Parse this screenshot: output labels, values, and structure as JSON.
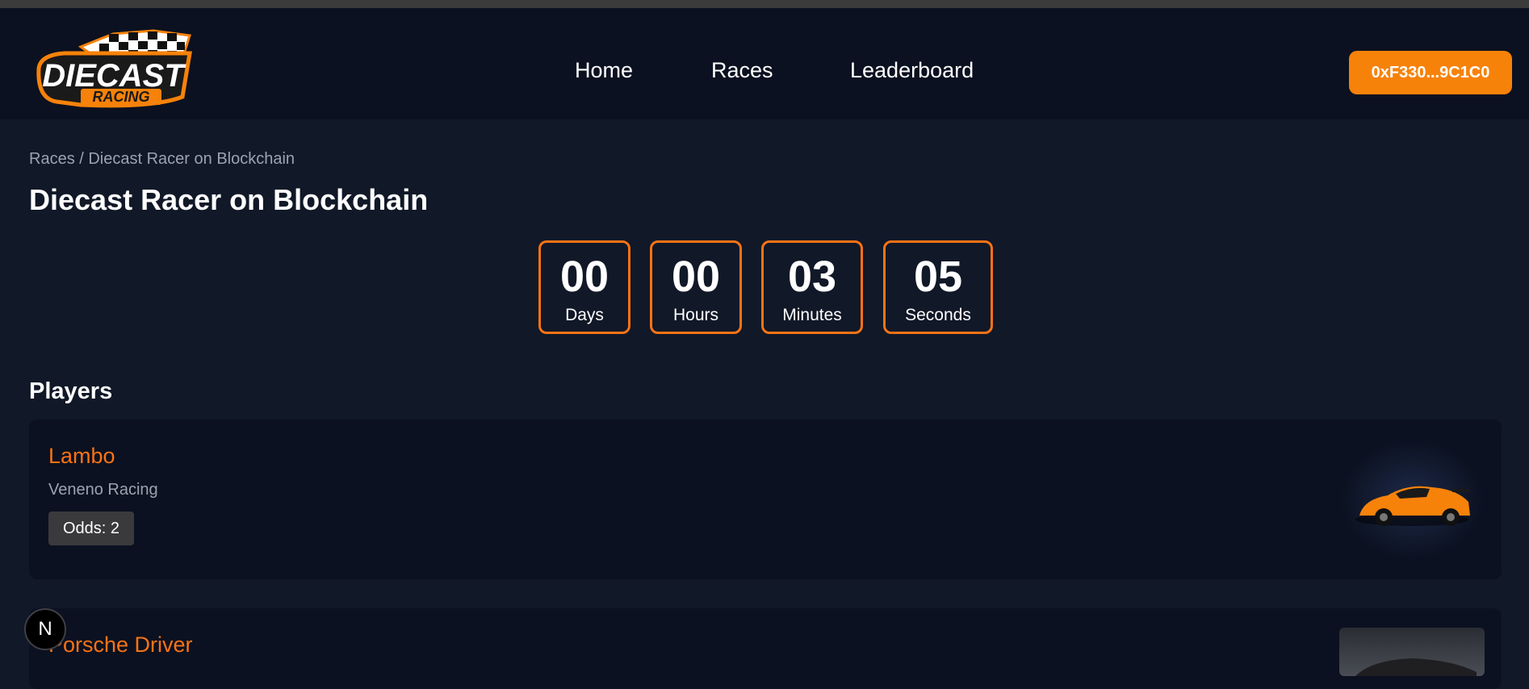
{
  "header": {
    "logo": {
      "line1": "DIECAST",
      "line2": "RACING"
    },
    "nav": [
      {
        "label": "Home"
      },
      {
        "label": "Races"
      },
      {
        "label": "Leaderboard"
      }
    ],
    "wallet_label": "0xF330...9C1C0"
  },
  "breadcrumb": "Races / Diecast Racer on Blockchain",
  "title": "Diecast Racer on Blockchain",
  "countdown": [
    {
      "value": "00",
      "label": "Days"
    },
    {
      "value": "00",
      "label": "Hours"
    },
    {
      "value": "03",
      "label": "Minutes"
    },
    {
      "value": "05",
      "label": "Seconds"
    }
  ],
  "players_heading": "Players",
  "players": [
    {
      "name": "Lambo",
      "team": "Veneno Racing",
      "odds": "Odds: 2",
      "car_color": "#f7820a"
    },
    {
      "name": "Porsche Driver",
      "team": "",
      "odds": "",
      "car_color": "#1f1f22"
    }
  ],
  "colors": {
    "accent": "#f97316",
    "background": "#111827",
    "navbar": "#0b1120"
  },
  "icons": {
    "framework_badge": "N"
  }
}
